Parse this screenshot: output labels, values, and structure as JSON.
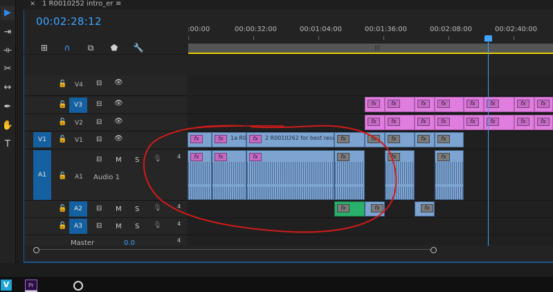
{
  "sequence": {
    "tab_title": "1 R0010252 intro_er",
    "close_glyph": "×",
    "menu_glyph": "≡",
    "timecode": "00:02:28:12"
  },
  "ruler": {
    "labels": [
      ":00:00",
      "00:00:32:00",
      "00:01:04:00",
      "00:01:36:00",
      "00:02:08:00",
      "00:02:40:00"
    ]
  },
  "tracks": {
    "video": [
      {
        "name": "V4",
        "targeted": false
      },
      {
        "name": "V3",
        "targeted": true
      },
      {
        "name": "V2",
        "targeted": false
      },
      {
        "name": "V1",
        "targeted": false,
        "source_patch": "V1"
      }
    ],
    "audio": [
      {
        "name": "A1",
        "label": "Audio 1",
        "source_patch": "A1",
        "mute": "M",
        "solo": "S",
        "volume": "4"
      },
      {
        "name": "A2",
        "targeted": true,
        "mute": "M",
        "solo": "S",
        "volume": "4"
      },
      {
        "name": "A3",
        "targeted": true,
        "mute": "M",
        "solo": "S",
        "volume": "4"
      }
    ],
    "master": {
      "label": "Master",
      "value": "0.0",
      "volume": "4"
    }
  },
  "clips": {
    "fx_label": "fx",
    "v1_clip_1": "1a R0",
    "v1_clip_2": "2 R0010262 for best resu"
  },
  "colors": {
    "accent": "#3ea4ff",
    "video_clip": "#e07ee0",
    "v1_clip": "#7da3d0",
    "audio_clip": "#7da3d0",
    "audio_green": "#29b06a",
    "work_area": "#e5d400",
    "annotation": "#d41a1a"
  },
  "taskbar": {
    "app1": "V",
    "app2": "Pr"
  }
}
